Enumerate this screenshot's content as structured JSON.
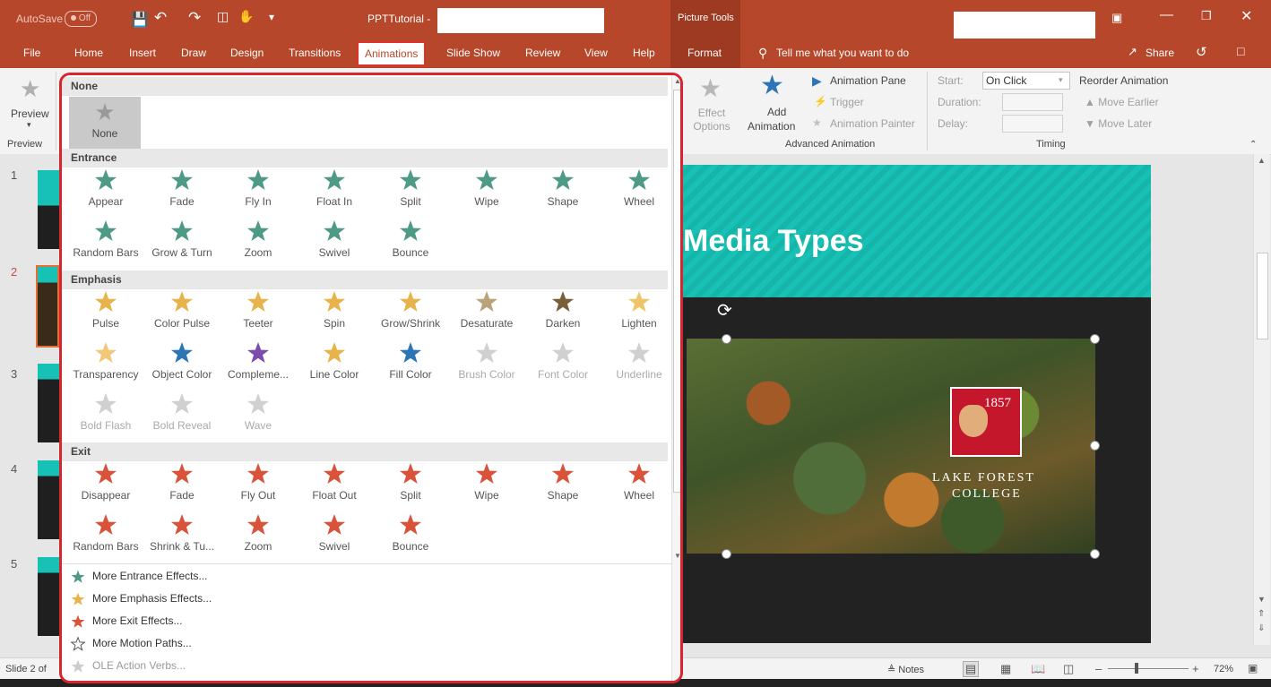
{
  "titlebar": {
    "autosave_label": "AutoSave",
    "autosave_state": "Off",
    "doc_title": "PPTTutorial -",
    "picture_tools": "Picture Tools"
  },
  "tabs": [
    "File",
    "Home",
    "Insert",
    "Draw",
    "Design",
    "Transitions",
    "Animations",
    "Slide Show",
    "Review",
    "View",
    "Help"
  ],
  "context_tab": "Format",
  "tell_me": "Tell me what you want to do",
  "share": "Share",
  "ribbon": {
    "preview": "Preview",
    "preview_group": "Preview",
    "effect_options": "Effect Options",
    "add_animation_1": "Add",
    "add_animation_2": "Animation",
    "animation_pane": "Animation Pane",
    "trigger": "Trigger",
    "animation_painter": "Animation Painter",
    "advanced_group": "Advanced Animation",
    "start_label": "Start:",
    "start_value": "On Click",
    "duration_label": "Duration:",
    "delay_label": "Delay:",
    "timing_group": "Timing",
    "reorder": "Reorder Animation",
    "move_earlier": "Move Earlier",
    "move_later": "Move Later"
  },
  "gallery": {
    "none_header": "None",
    "none_item": "None",
    "entrance_header": "Entrance",
    "entrance": [
      "Appear",
      "Fade",
      "Fly In",
      "Float In",
      "Split",
      "Wipe",
      "Shape",
      "Wheel",
      "Random Bars",
      "Grow & Turn",
      "Zoom",
      "Swivel",
      "Bounce"
    ],
    "emphasis_header": "Emphasis",
    "emphasis": [
      "Pulse",
      "Color Pulse",
      "Teeter",
      "Spin",
      "Grow/Shrink",
      "Desaturate",
      "Darken",
      "Lighten",
      "Transparency",
      "Object Color",
      "Compleme...",
      "Line Color",
      "Fill Color",
      "Brush Color",
      "Font Color",
      "Underline",
      "Bold Flash",
      "Bold Reveal",
      "Wave"
    ],
    "exit_header": "Exit",
    "exit": [
      "Disappear",
      "Fade",
      "Fly Out",
      "Float Out",
      "Split",
      "Wipe",
      "Shape",
      "Wheel",
      "Random Bars",
      "Shrink & Tu...",
      "Zoom",
      "Swivel",
      "Bounce"
    ],
    "more": [
      "More Entrance Effects...",
      "More Emphasis Effects...",
      "More Exit Effects...",
      "More Motion Paths...",
      "OLE Action Verbs..."
    ]
  },
  "slide": {
    "title": "Media Types",
    "crest_year": "1857",
    "college_line1": "LAKE FOREST",
    "college_line2": "COLLEGE"
  },
  "thumbnails": [
    "1",
    "2",
    "3",
    "4",
    "5"
  ],
  "status": {
    "slide_of": "Slide 2 of",
    "notes": "Notes",
    "zoom": "72%"
  },
  "colors": {
    "accent": "#b7472a",
    "entrance": "#4f9a86",
    "emphasis": "#e8b34a",
    "exit": "#d9533a",
    "highlight": "#d9262e"
  }
}
